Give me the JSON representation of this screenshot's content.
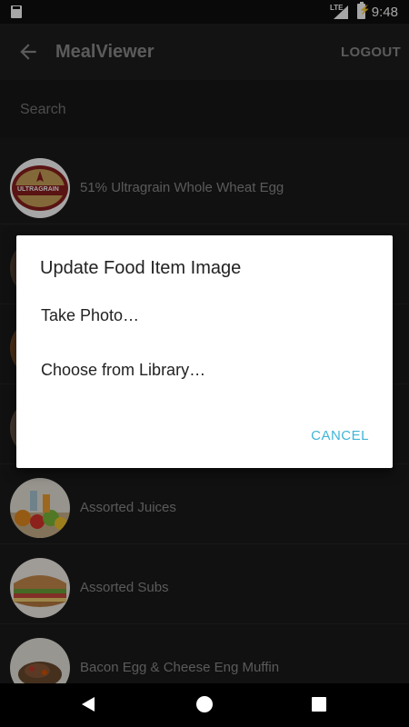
{
  "status_bar": {
    "network": "LTE",
    "time": "9:48"
  },
  "app_bar": {
    "title": "MealViewer",
    "logout_label": "LOGOUT"
  },
  "search": {
    "placeholder": "Search",
    "value": ""
  },
  "list": {
    "items": [
      {
        "label": "51% Ultragrain Whole Wheat Egg",
        "logo_text": "ULTRAGRAIN"
      },
      {
        "label": ""
      },
      {
        "label": ""
      },
      {
        "label": ""
      },
      {
        "label": "Assorted Juices"
      },
      {
        "label": "Assorted Subs"
      },
      {
        "label": "Bacon Egg & Cheese Eng Muffin"
      }
    ]
  },
  "dialog": {
    "title": "Update Food Item Image",
    "options": [
      "Take Photo…",
      "Choose from Library…"
    ],
    "cancel_label": "CANCEL"
  },
  "colors": {
    "accent": "#3fb5d6",
    "background": "#1b1b1b",
    "dialog": "#ffffff"
  }
}
